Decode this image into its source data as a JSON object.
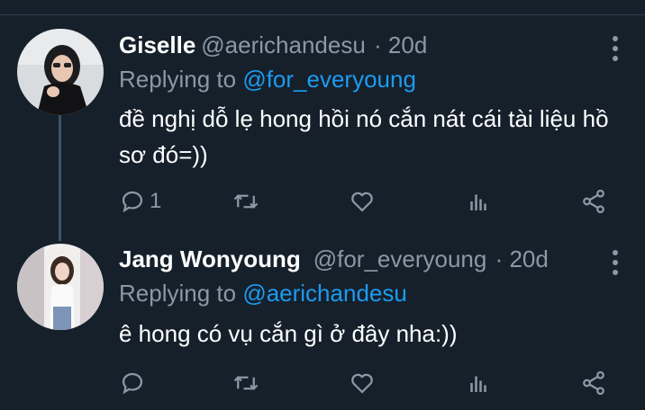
{
  "tweets": [
    {
      "name": "Giselle",
      "handle": "@aerichandesu",
      "time": "· 20d",
      "replying_prefix": "Replying to ",
      "replying_to": "@for_everyoung",
      "text": "đề nghị dỗ lẹ hong hồi nó cắn nát cái tài liệu hồ sơ đó=))",
      "reply_count": "1"
    },
    {
      "name": "Jang Wonyoung",
      "handle": "@for_everyoung",
      "time": "· 20d",
      "replying_prefix": "Replying to ",
      "replying_to": "@aerichandesu",
      "text": "ê hong có vụ cắn gì ở đây nha:))",
      "reply_count": ""
    }
  ],
  "icons": {
    "reply": "reply-icon",
    "retweet": "retweet-icon",
    "like": "heart-icon",
    "stats": "analytics-icon",
    "share": "share-icon",
    "more": "more-vertical-icon"
  },
  "colors": {
    "background": "#15202b",
    "mention": "#1d9bf0",
    "muted": "#8b98a5"
  }
}
